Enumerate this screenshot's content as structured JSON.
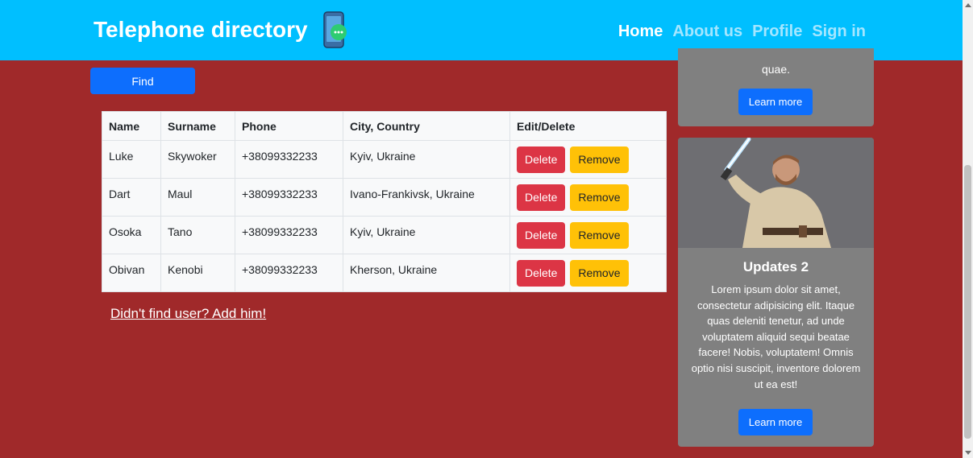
{
  "header": {
    "brand": "Telephone directory",
    "nav": [
      "Home",
      "About us",
      "Profile",
      "Sign in"
    ]
  },
  "search": {
    "find_label": "Find"
  },
  "table": {
    "headers": [
      "Name",
      "Surname",
      "Phone",
      "City, Country",
      "Edit/Delete"
    ],
    "rows": [
      {
        "name": "Luke",
        "surname": "Skywoker",
        "phone": "+38099332233",
        "city": "Kyiv, Ukraine"
      },
      {
        "name": "Dart",
        "surname": "Maul",
        "phone": "+38099332233",
        "city": "Ivano-Frankivsk, Ukraine"
      },
      {
        "name": "Osoka",
        "surname": "Tano",
        "phone": "+38099332233",
        "city": "Kyiv, Ukraine"
      },
      {
        "name": "Obivan",
        "surname": "Kenobi",
        "phone": "+38099332233",
        "city": "Kherson, Ukraine"
      }
    ],
    "delete_label": "Delete",
    "remove_label": "Remove"
  },
  "add_user_link": "Didn't find user? Add him!",
  "cards": [
    {
      "text": "quae.",
      "button": "Learn more"
    },
    {
      "title": "Updates 2",
      "text": "Lorem ipsum dolor sit amet, consectetur adipisicing elit. Itaque quas deleniti tenetur, ad unde voluptatem aliquid sequi beatae facere! Nobis, voluptatem! Omnis optio nisi suscipit, inventore dolorem ut ea est!",
      "button": "Learn more"
    }
  ],
  "colors": {
    "navbar": "#00bfff",
    "background": "#a0292a",
    "primary": "#0d6efd",
    "danger": "#dc3545",
    "warning": "#ffc107",
    "card": "#808080"
  }
}
